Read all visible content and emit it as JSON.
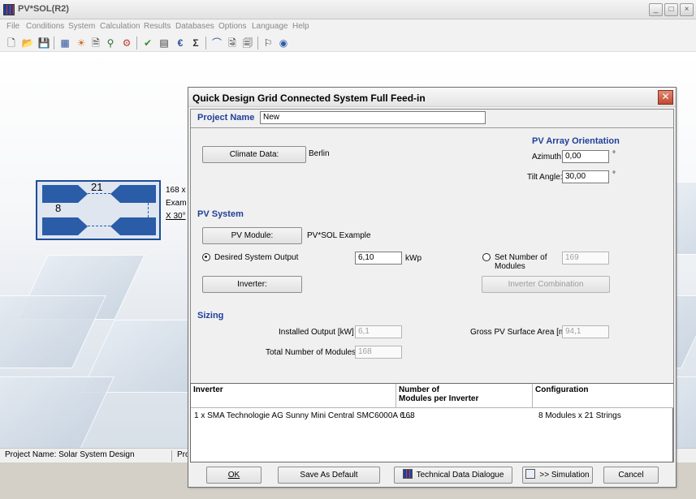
{
  "app": {
    "title": "PV*SOL(R2)",
    "window_buttons": [
      "_",
      "□",
      "×"
    ]
  },
  "menu": [
    "File",
    "Conditions",
    "System",
    "Calculation",
    "Results",
    "Databases",
    "Options",
    "Language",
    "Help"
  ],
  "diagram": {
    "top_count": "21",
    "left_count": "8",
    "side_lines": [
      "168 x",
      "Exam",
      "X 30°"
    ]
  },
  "statusbar": {
    "project": "Project Name: Solar System Design",
    "second": "Pro"
  },
  "dialog": {
    "title": "Quick Design Grid Connected System Full Feed-in",
    "project_name_label": "Project Name",
    "project_name_value": "New",
    "climate_button": "Climate Data:",
    "climate_value": "Berlin",
    "orientation_title": "PV Array Orientation",
    "azimuth_label": "Azimuth:",
    "azimuth_value": "0,00",
    "tilt_label": "Tilt Angle:",
    "tilt_value": "30,00",
    "degree": "°",
    "pv_system_title": "PV System",
    "pv_module_button": "PV Module:",
    "pv_module_value": "PV*SOL Example",
    "desired_output_label": "Desired System Output",
    "desired_output_value": "6,10",
    "desired_output_unit": "kWp",
    "set_number_label_1": "Set Number of",
    "set_number_label_2": "Modules",
    "set_number_value": "169",
    "inverter_button": "Inverter:",
    "inverter_combination_button": "Inverter Combination",
    "sizing_title": "Sizing",
    "installed_output_label": "Installed Output [kW]",
    "installed_output_value": "6,1",
    "gross_area_label": "Gross PV Surface Area [m²]",
    "gross_area_value": "94,1",
    "total_modules_label": "Total Number of Modules",
    "total_modules_value": "168",
    "table": {
      "headers": [
        "Inverter",
        "Number of\nModules per Inverter",
        "Configuration"
      ],
      "header_line2": "Modules per Inverter",
      "header_line1": "Number of",
      "rows": [
        [
          "1 x SMA Technologie AG Sunny Mini Central SMC6000A 6....",
          "168",
          "8 Modules x 21 Strings"
        ]
      ]
    },
    "buttons": {
      "ok": "OK",
      "save_default": "Save As Default",
      "technical": "Technical Data Dialogue",
      "simulation": ">> Simulation",
      "cancel": "Cancel"
    }
  }
}
